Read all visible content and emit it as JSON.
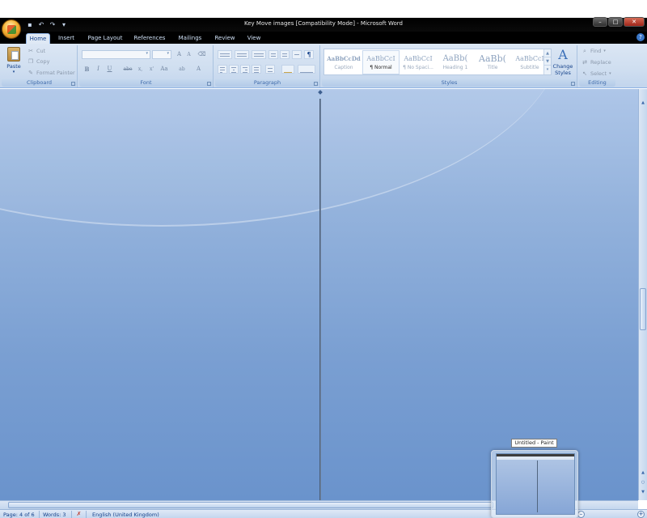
{
  "window": {
    "title": "Key Move images [Compatibility Mode] - Microsoft Word"
  },
  "tabs": [
    "Home",
    "Insert",
    "Page Layout",
    "References",
    "Mailings",
    "Review",
    "View"
  ],
  "ribbon": {
    "clipboard": {
      "paste_label": "Paste",
      "cut_label": "Cut",
      "copy_label": "Copy",
      "format_painter_label": "Format Painter",
      "group_label": "Clipboard"
    },
    "font": {
      "group_label": "Font",
      "grow_label": "A",
      "shrink_label": "A",
      "bold_label": "B",
      "italic_label": "I",
      "underline_label": "U",
      "strike_label": "abe",
      "subscript_label": "x,",
      "superscript_label": "x'",
      "change_case_label": "Aa",
      "highlight_label": "ab",
      "color_label": "A"
    },
    "paragraph": {
      "group_label": "Paragraph",
      "pilcrow_label": "¶"
    },
    "styles": {
      "group_label": "Styles",
      "items": [
        {
          "sample": "AaBbCcDd",
          "name": "Caption"
        },
        {
          "sample": "AaBbCcI",
          "name": "¶ Normal"
        },
        {
          "sample": "AaBbCcI",
          "name": "¶ No Spaci..."
        },
        {
          "sample": "AaBb(",
          "name": "Heading 1"
        },
        {
          "sample": "AaBb(",
          "name": "Title"
        },
        {
          "sample": "AaBbCcI",
          "name": "Subtitle"
        }
      ],
      "change_styles_label_1": "Change",
      "change_styles_label_2": "Styles"
    },
    "editing": {
      "group_label": "Editing",
      "find_label": "Find",
      "replace_label": "Replace",
      "select_label": "Select"
    }
  },
  "statusbar": {
    "page": "Page: 4 of 6",
    "words": "Words: 3",
    "language": "English (United Kingdom)"
  },
  "taskbar_preview": {
    "tooltip": "Untitled - Paint"
  },
  "colors": {
    "ribbon_bg": "#cfdef0",
    "document_bg": "#7a9fd2",
    "title_bar": "#000000",
    "accent": "#15428b"
  }
}
